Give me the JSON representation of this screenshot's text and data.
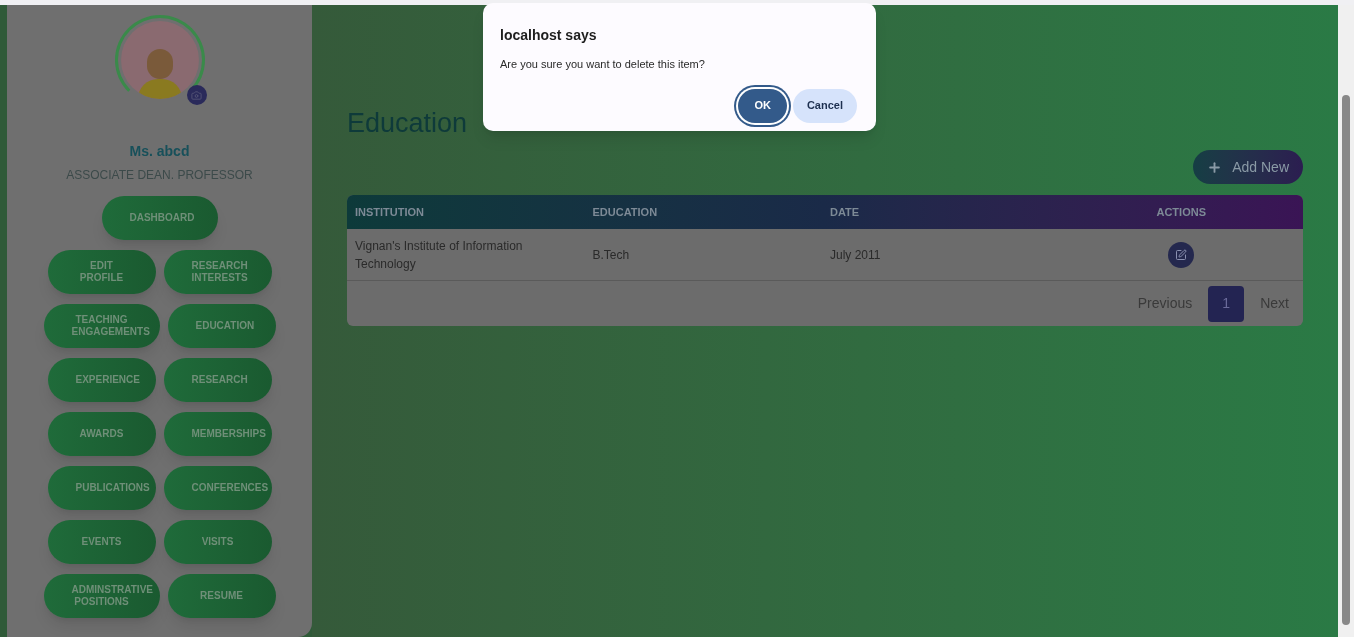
{
  "profile": {
    "name": "Ms. abcd",
    "role": "ASSOCIATE DEAN. PROFESSOR"
  },
  "nav": [
    [
      "DASHBOARD"
    ],
    [
      "EDIT PROFILE",
      "RESEARCH INTERESTS"
    ],
    [
      "TEACHING ENGAGEMENTS",
      "EDUCATION"
    ],
    [
      "EXPERIENCE",
      "RESEARCH"
    ],
    [
      "AWARDS",
      "MEMBERSHIPS"
    ],
    [
      "PUBLICATIONS",
      "CONFERENCES"
    ],
    [
      "EVENTS",
      "VISITS"
    ],
    [
      "ADMINSTRATIVE POSITIONS",
      "RESUME"
    ]
  ],
  "page": {
    "title": "Education",
    "add_button": "Add New"
  },
  "table": {
    "columns": [
      "INSTITUTION",
      "EDUCATION",
      "DATE",
      "ACTIONS"
    ],
    "rows": [
      [
        "Vignan's Institute of Information Technology",
        "B.Tech",
        "July 2011"
      ]
    ]
  },
  "pagination": {
    "previous": "Previous",
    "pages": [
      {
        "label": "1",
        "selected": true
      }
    ],
    "next": "Next"
  },
  "dialog": {
    "title": "localhost says",
    "message": "Are you sure you want to delete this item?",
    "buttons": [
      {
        "label": "OK",
        "kind": "primary"
      },
      {
        "label": "Cancel",
        "kind": "secondary"
      }
    ]
  }
}
